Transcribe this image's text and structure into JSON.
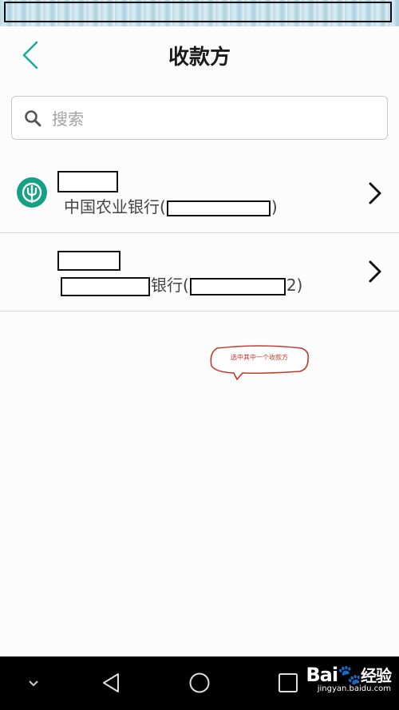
{
  "header": {
    "title": "收款方"
  },
  "search": {
    "placeholder": "搜索"
  },
  "payees": [
    {
      "bank_name": "中国农业银行(",
      "account_suffix": ")",
      "icon": "abc-bank-logo-icon"
    },
    {
      "bank_name": "银行(",
      "account_suffix": "2)"
    }
  ],
  "annotation": {
    "text": "选中其中一个收款方"
  },
  "watermark": {
    "brand_left": "Bai",
    "brand_right": "经验",
    "url": "jingyan.baidu.com"
  },
  "colors": {
    "accent": "#1aab9b",
    "bank_green": "#16a085",
    "annotation_red": "#c0392b",
    "navbar": "#000000"
  }
}
